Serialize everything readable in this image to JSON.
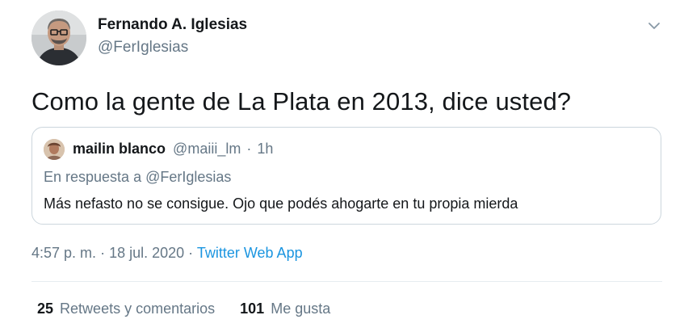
{
  "author": {
    "name": "Fernando A. Iglesias",
    "handle": "@FerIglesias"
  },
  "tweet": {
    "text": "Como la gente de La Plata en 2013, dice usted?"
  },
  "quoted": {
    "name": "mailin blanco",
    "handle": "@maiii_lm",
    "separator": "·",
    "time": "1h",
    "reply_prefix": "En respuesta a",
    "reply_to": "@FerIglesias",
    "text": "Más nefasto no se consigue. Ojo que podés ahogarte en tu propia mierda"
  },
  "meta": {
    "time": "4:57 p. m.",
    "date": "18 jul. 2020",
    "separator": "·",
    "source": "Twitter Web App"
  },
  "stats": {
    "retweets_count": "25",
    "retweets_label": "Retweets y comentarios",
    "likes_count": "101",
    "likes_label": "Me gusta"
  },
  "icons": {
    "caret": "chevron-down-icon"
  },
  "colors": {
    "text_primary": "#14171a",
    "text_secondary": "#657786",
    "link": "#1b95e0",
    "border": "#ccd6dd"
  }
}
